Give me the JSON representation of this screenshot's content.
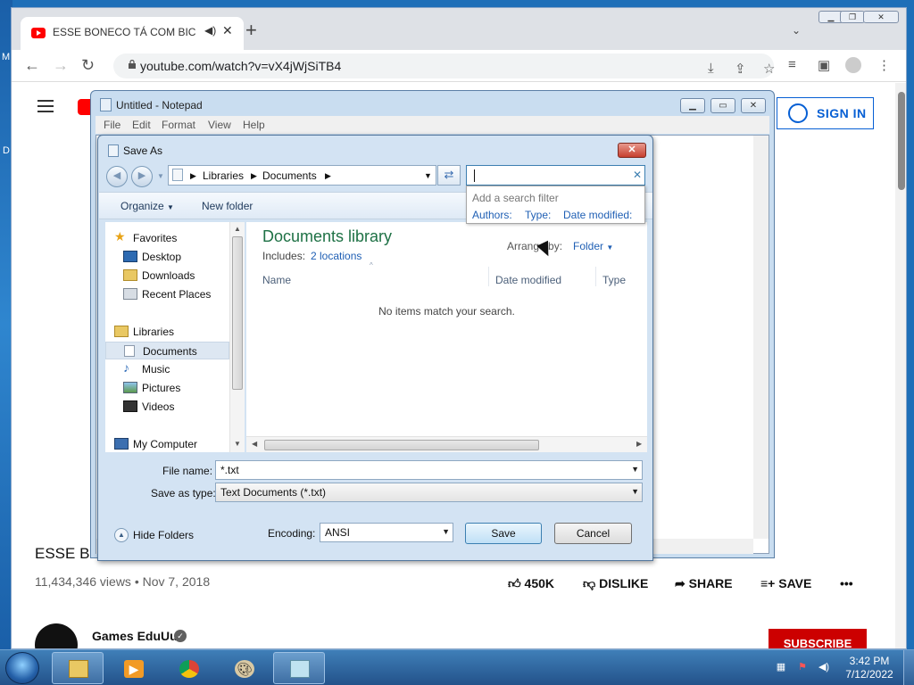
{
  "desktop": {
    "edge_letters": [
      "M",
      "D"
    ]
  },
  "browser": {
    "tab_title": "ESSE BONECO TÁ COM BICHO",
    "url": "youtube.com/watch?v=vX4jWjSiTB4"
  },
  "youtube": {
    "sign_in": "SIGN IN",
    "video_title": "ESSE BO",
    "views_date": "11,434,346 views • Nov 7, 2018",
    "likes": "450K",
    "dislike": "DISLIKE",
    "share": "SHARE",
    "save": "SAVE",
    "more": "•••",
    "channel": "Games EduUu",
    "subscribe": "SUBSCRIBE"
  },
  "notepad": {
    "title": "Untitled - Notepad",
    "menu": [
      "File",
      "Edit",
      "Format",
      "View",
      "Help"
    ]
  },
  "save_dialog": {
    "title": "Save As",
    "breadcrumb": [
      "Libraries",
      "Documents"
    ],
    "toolbar": {
      "organize": "Organize",
      "new_folder": "New folder"
    },
    "nav": {
      "favorites": "Favorites",
      "desktop": "Desktop",
      "downloads": "Downloads",
      "recent": "Recent Places",
      "libraries": "Libraries",
      "documents": "Documents",
      "music": "Music",
      "pictures": "Pictures",
      "videos": "Videos",
      "computer": "My Computer"
    },
    "library_title": "Documents library",
    "includes_label": "Includes:",
    "locations": "2 locations",
    "arrange_label": "Arrange by:",
    "arrange_value": "Folder",
    "columns": {
      "name": "Name",
      "date": "Date modified",
      "type": "Type"
    },
    "empty_msg": "No items match your search.",
    "search_filter": {
      "hint": "Add a search filter",
      "authors": "Authors:",
      "type": "Type:",
      "date": "Date modified:"
    },
    "file_name_label": "File name:",
    "file_name_value": "*.txt",
    "save_type_label": "Save as type:",
    "save_type_value": "Text Documents (*.txt)",
    "encoding_label": "Encoding:",
    "encoding_value": "ANSI",
    "hide_folders": "Hide Folders",
    "save_btn": "Save",
    "cancel_btn": "Cancel"
  },
  "taskbar": {
    "time": "3:42 PM",
    "date": "7/12/2022"
  }
}
